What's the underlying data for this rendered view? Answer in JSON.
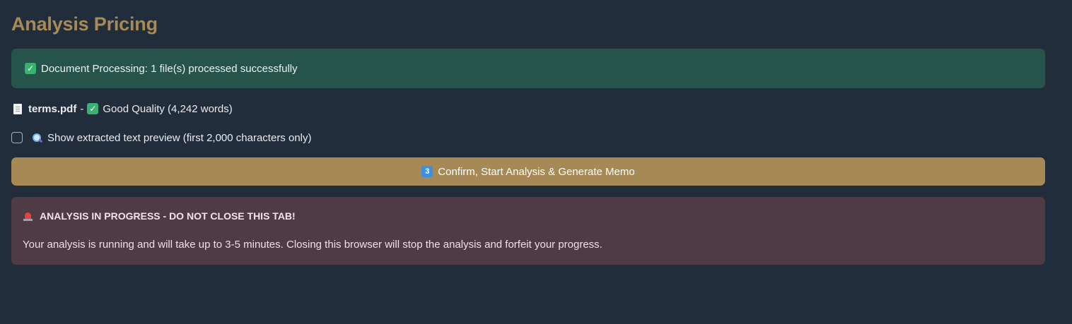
{
  "page": {
    "title": "Analysis Pricing"
  },
  "success_alert": {
    "icon": "check-mark-icon",
    "text": "Document Processing: 1 file(s) processed successfully",
    "color": "#26534a"
  },
  "file": {
    "icon": "document-icon",
    "name": "terms.pdf",
    "separator": "-",
    "quality_icon": "check-mark-icon",
    "quality_text": "Good Quality (4,242 words)"
  },
  "preview_toggle": {
    "checked": false,
    "icon": "magnifier-icon",
    "label": "Show extracted text preview (first 2,000 characters only)"
  },
  "confirm_button": {
    "icon": "keycap-3-icon",
    "icon_text": "3",
    "label": "Confirm, Start Analysis & Generate Memo",
    "color": "#a68954"
  },
  "warning_alert": {
    "icon": "siren-icon",
    "heading": "ANALYSIS IN PROGRESS - DO NOT CLOSE THIS TAB!",
    "body": "Your analysis is running and will take up to 3-5 minutes. Closing this browser will stop the analysis and forfeit your progress.",
    "color": "#4e3b46"
  }
}
